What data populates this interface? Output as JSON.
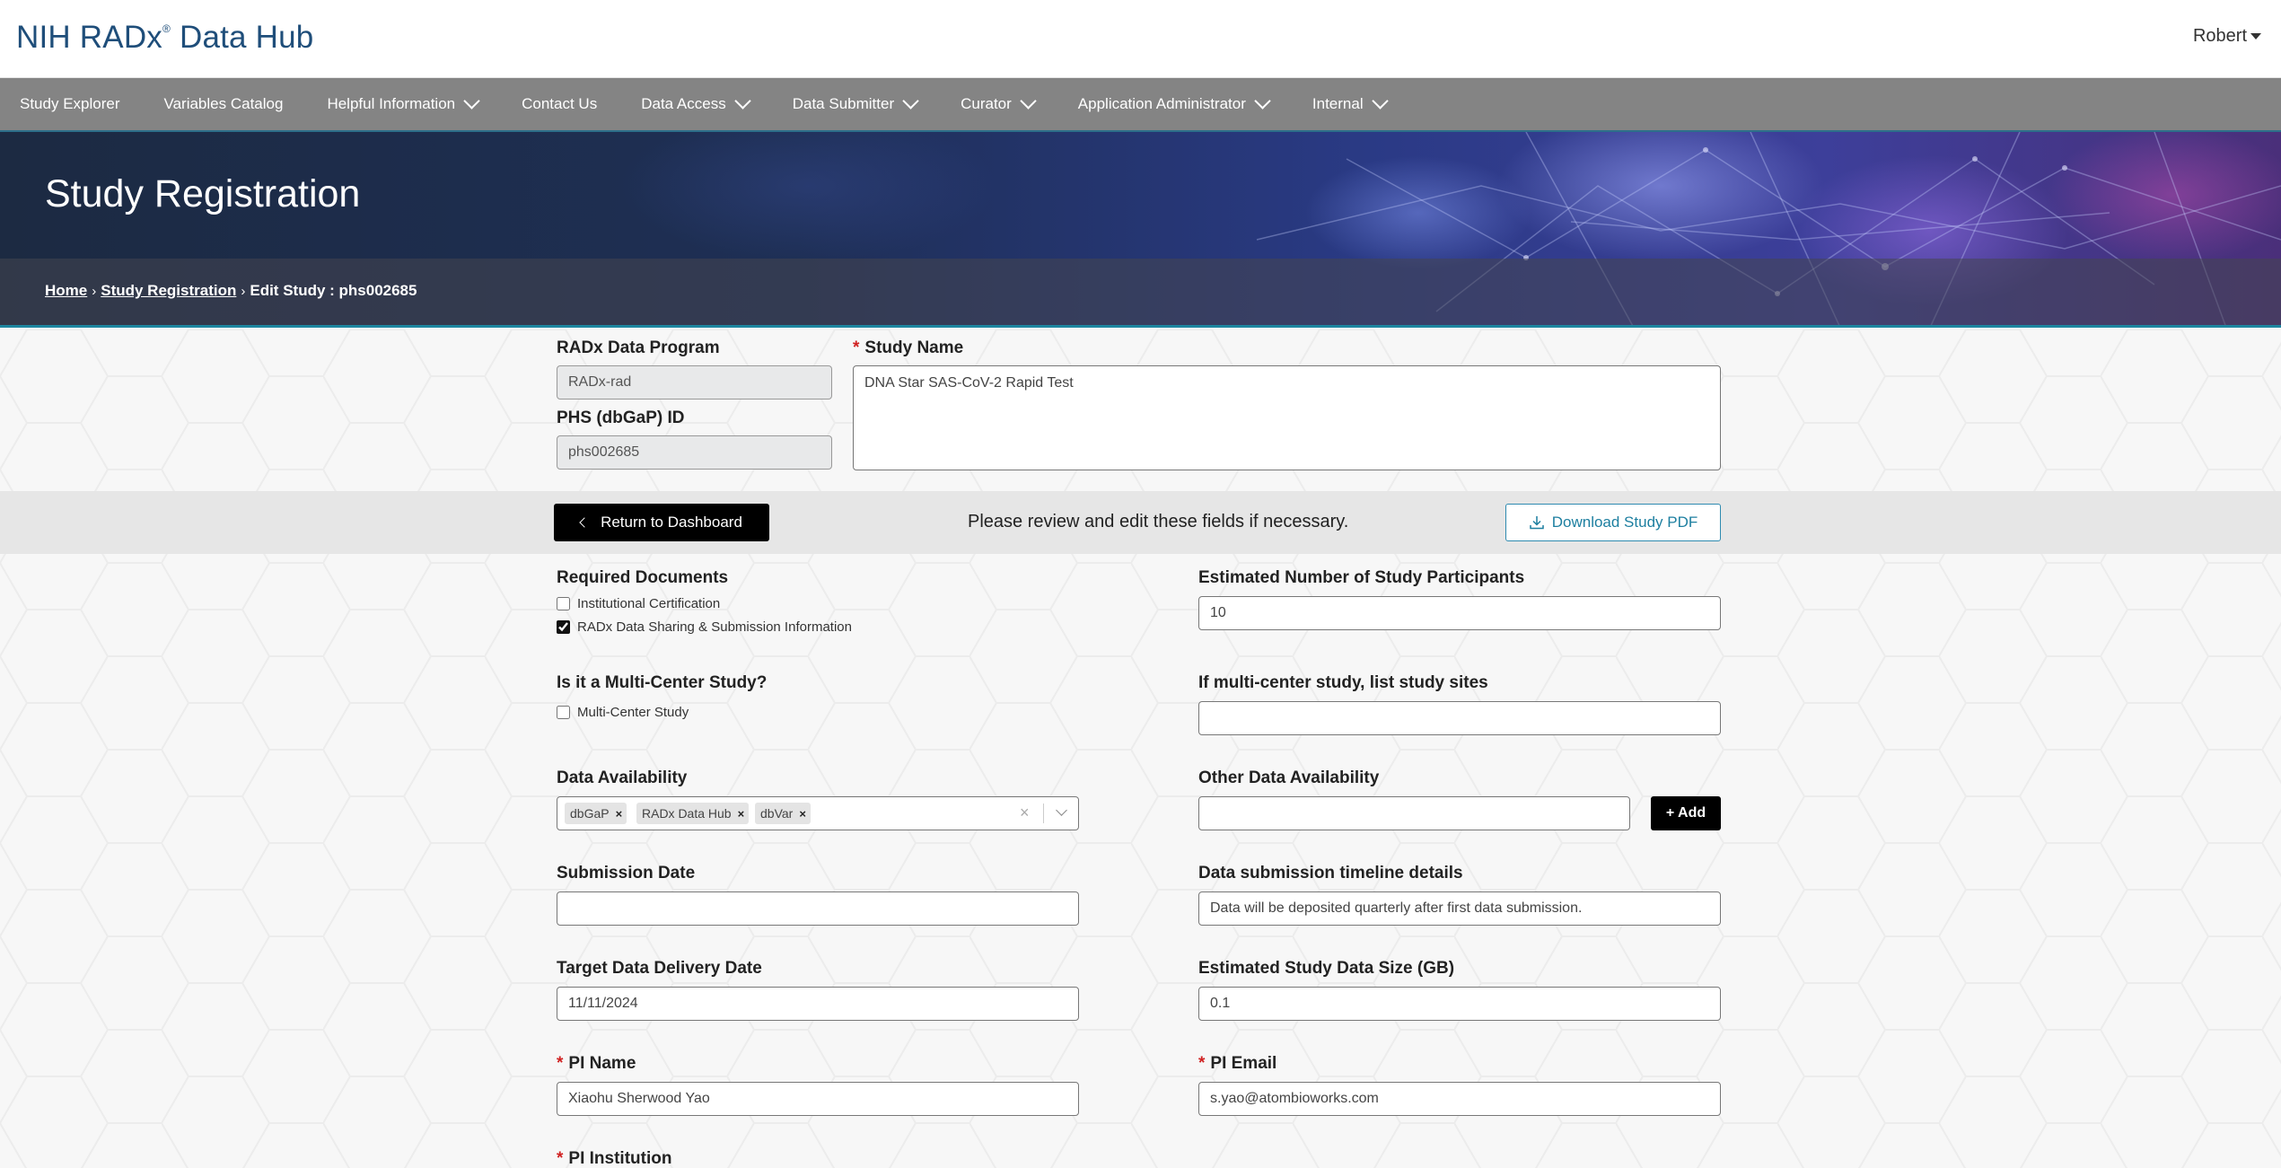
{
  "header": {
    "brand": "NIH RADx",
    "brand_mark": "®",
    "brand_suffix": "Data Hub",
    "user": "Robert"
  },
  "nav": {
    "items": [
      {
        "label": "Study Explorer",
        "dropdown": false
      },
      {
        "label": "Variables Catalog",
        "dropdown": false
      },
      {
        "label": "Helpful Information",
        "dropdown": true
      },
      {
        "label": "Contact Us",
        "dropdown": false
      },
      {
        "label": "Data Access",
        "dropdown": true
      },
      {
        "label": "Data Submitter",
        "dropdown": true
      },
      {
        "label": "Curator",
        "dropdown": true
      },
      {
        "label": "Application Administrator",
        "dropdown": true
      },
      {
        "label": "Internal",
        "dropdown": true
      }
    ]
  },
  "hero": {
    "title": "Study Registration",
    "breadcrumb": {
      "home": "Home",
      "study_registration": "Study Registration",
      "current": "Edit Study : phs002685",
      "separator": "›"
    }
  },
  "form_top": {
    "program_label": "RADx Data Program",
    "program_value": "RADx-rad",
    "phs_label": "PHS (dbGaP) ID",
    "phs_value": "phs002685",
    "study_name_label": "Study Name",
    "study_name_value": "DNA Star SAS-CoV-2 Rapid Test",
    "required_mark": "*"
  },
  "actions": {
    "return_label": "Return to Dashboard",
    "message": "Please review and edit these fields if necessary.",
    "download_label": "Download Study PDF"
  },
  "form": {
    "required_docs_label": "Required Documents",
    "doc_institutional": "Institutional Certification",
    "doc_institutional_checked": false,
    "doc_radx_sharing": "RADx Data Sharing & Submission Information",
    "doc_radx_sharing_checked": true,
    "participants_label": "Estimated Number of Study Participants",
    "participants_value": "10",
    "multicenter_label": "Is it a Multi-Center Study?",
    "multicenter_checkbox": "Multi-Center Study",
    "multicenter_checked": false,
    "sites_label": "If multi-center study, list study sites",
    "sites_value": "",
    "availability_label": "Data Availability",
    "availability_chips": [
      "dbGaP",
      "RADx Data Hub",
      "dbVar"
    ],
    "chip_remove": "×",
    "clear_all": "×",
    "other_availability_label": "Other Data Availability",
    "other_availability_value": "",
    "add_label": "+ Add",
    "submission_date_label": "Submission Date",
    "submission_date_value": "",
    "timeline_label": "Data submission timeline details",
    "timeline_value": "Data will be deposited quarterly after first data submission.",
    "target_date_label": "Target Data Delivery Date",
    "target_date_value": "11/11/2024",
    "data_size_label": "Estimated Study Data Size (GB)",
    "data_size_value": "0.1",
    "pi_name_label": "PI Name",
    "pi_name_value": "Xiaohu Sherwood Yao",
    "pi_email_label": "PI Email",
    "pi_email_value": "s.yao@atombioworks.com",
    "pi_institution_label": "PI Institution"
  },
  "colors": {
    "brand": "#1f4e7a",
    "nav_bg": "#848484",
    "accent": "#1d86a0",
    "required": "#d02020",
    "download_text": "#1d7fa0"
  }
}
